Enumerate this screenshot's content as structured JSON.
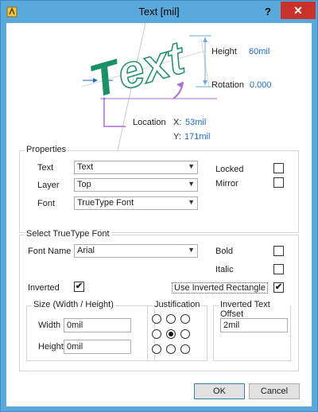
{
  "window": {
    "title": "Text  [mil]",
    "help": "?",
    "close": "✕"
  },
  "preview": {
    "height_label": "Height",
    "height_value": "60mil",
    "rotation_label": "Rotation",
    "rotation_value": "0.000",
    "location_label": "Location",
    "x_label": "X:",
    "x_value": "53mil",
    "y_label": "Y:",
    "y_value": "171mil",
    "sample_text": "Text"
  },
  "properties": {
    "title": "Properties",
    "text_label": "Text",
    "text_value": "Text",
    "layer_label": "Layer",
    "layer_value": "Top",
    "font_label": "Font",
    "font_value": "TrueType Font",
    "locked_label": "Locked",
    "locked": false,
    "mirror_label": "Mirror",
    "mirror": false
  },
  "truetype": {
    "title": "Select TrueType Font",
    "font_name_label": "Font Name",
    "font_name_value": "Arial",
    "bold_label": "Bold",
    "bold": false,
    "italic_label": "Italic",
    "italic": false,
    "inverted_label": "Inverted",
    "inverted": true,
    "use_inv_rect_label": "Use Inverted Rectangle",
    "use_inv_rect": true,
    "size_title": "Size (Width / Height)",
    "width_label": "Width",
    "width_value": "0mil",
    "height_label": "Height",
    "height_value": "0mil",
    "justification_title": "Justification",
    "justification_selected": 4,
    "offset_title": "Inverted Text Offset",
    "offset_value": "2mil"
  },
  "buttons": {
    "ok": "OK",
    "cancel": "Cancel"
  },
  "colors": {
    "accent": "#1a8f68",
    "value_blue": "#1a6ad0",
    "dimension": "#b26bd1",
    "guide": "#6aa8e0"
  }
}
